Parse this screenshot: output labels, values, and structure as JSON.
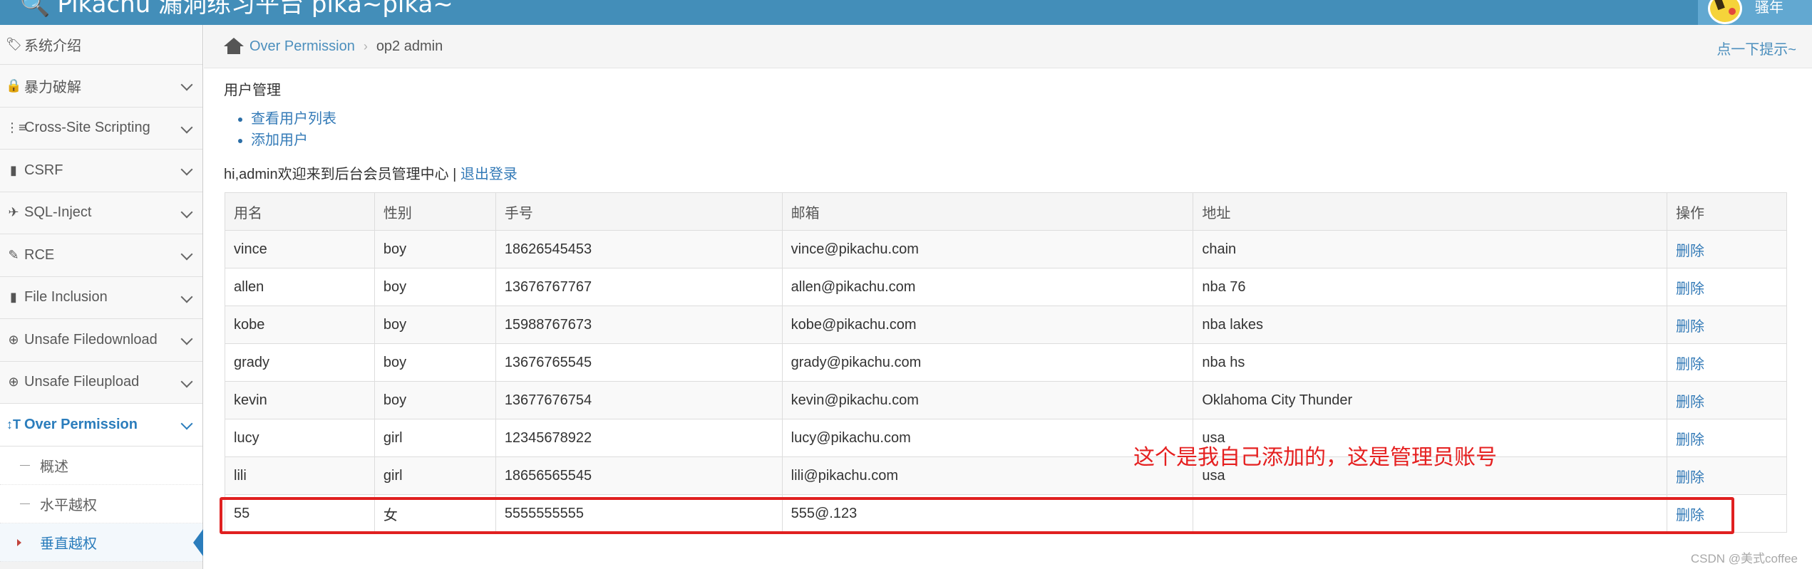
{
  "header": {
    "brand": "Pikachu 漏洞练习平台 pika~pika~",
    "user_name": "骚年",
    "colors": {
      "bar": "#438eb9",
      "user_area": "#62a8d1"
    }
  },
  "sidebar": {
    "items": [
      {
        "label": "系统介绍",
        "icon": "tag-icon"
      },
      {
        "label": "暴力破解",
        "icon": "lock-icon"
      },
      {
        "label": "Cross-Site Scripting",
        "icon": "list-tree-icon"
      },
      {
        "label": "CSRF",
        "icon": "file-icon"
      },
      {
        "label": "SQL-Inject",
        "icon": "plane-icon"
      },
      {
        "label": "RCE",
        "icon": "pencil-icon"
      },
      {
        "label": "File Inclusion",
        "icon": "file-icon"
      },
      {
        "label": "Unsafe Filedownload",
        "icon": "download-circle-icon"
      },
      {
        "label": "Unsafe Fileupload",
        "icon": "upload-circle-icon"
      },
      {
        "label": "Over Permission",
        "icon": "text-height-icon"
      }
    ],
    "sub_items": [
      {
        "label": "概述"
      },
      {
        "label": "水平越权"
      },
      {
        "label": "垂直越权"
      }
    ]
  },
  "breadcrumb": {
    "parent": "Over Permission",
    "current": "op2 admin",
    "hint": "点一下提示~"
  },
  "main": {
    "section_title": "用户管理",
    "links": [
      "查看用户列表",
      "添加用户"
    ],
    "welcome": "hi,admin欢迎来到后台会员管理中心 |",
    "logout": "退出登录"
  },
  "table": {
    "headers": [
      "用名",
      "性别",
      "手号",
      "邮箱",
      "地址",
      "操作"
    ],
    "rows": [
      {
        "name": "vince",
        "sex": "boy",
        "phone": "18626545453",
        "email": "vince@pikachu.com",
        "address": "chain",
        "op": "删除"
      },
      {
        "name": "allen",
        "sex": "boy",
        "phone": "13676767767",
        "email": "allen@pikachu.com",
        "address": "nba 76",
        "op": "删除"
      },
      {
        "name": "kobe",
        "sex": "boy",
        "phone": "15988767673",
        "email": "kobe@pikachu.com",
        "address": "nba lakes",
        "op": "删除"
      },
      {
        "name": "grady",
        "sex": "boy",
        "phone": "13676765545",
        "email": "grady@pikachu.com",
        "address": "nba hs",
        "op": "删除"
      },
      {
        "name": "kevin",
        "sex": "boy",
        "phone": "13677676754",
        "email": "kevin@pikachu.com",
        "address": "Oklahoma City Thunder",
        "op": "删除"
      },
      {
        "name": "lucy",
        "sex": "girl",
        "phone": "12345678922",
        "email": "lucy@pikachu.com",
        "address": "usa",
        "op": "删除"
      },
      {
        "name": "lili",
        "sex": "girl",
        "phone": "18656565545",
        "email": "lili@pikachu.com",
        "address": "usa",
        "op": "删除"
      },
      {
        "name": "55",
        "sex": "女",
        "phone": "5555555555",
        "email": "555@.123",
        "address": "",
        "op": "删除"
      }
    ]
  },
  "annotation": {
    "text": "这个是我自己添加的，这是管理员账号",
    "color": "#e52020"
  },
  "watermark": "CSDN @美式coffee"
}
